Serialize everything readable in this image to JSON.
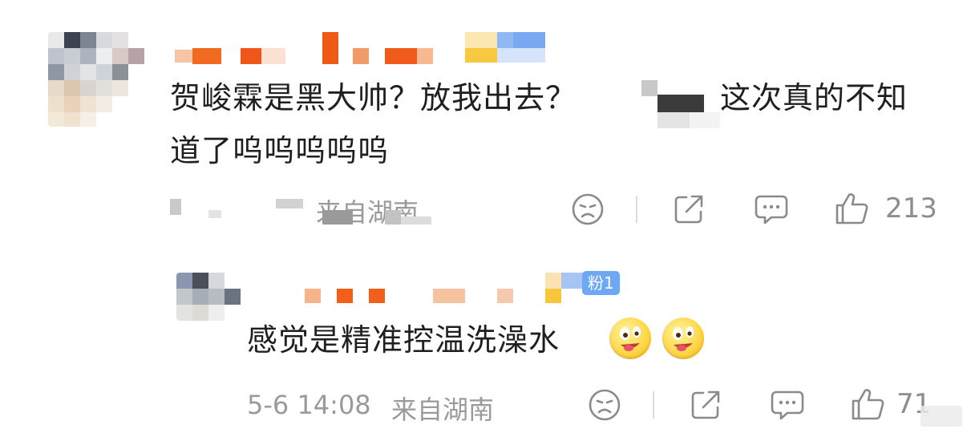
{
  "comment": {
    "text_line1_a": "贺峻霖是黑大帅？放我出去？",
    "text_line1_b": "这次真的不知",
    "text_line2": "道了呜呜呜呜呜",
    "meta_location": "来自湖南",
    "like_count": "213"
  },
  "reply": {
    "fan_badge": "粉1",
    "text": "感觉是精准控温洗澡水",
    "timestamp": "5-6 14:08",
    "location": "来自湖南",
    "like_count": "71"
  },
  "icons": {
    "dislike": "sad-face-icon",
    "share": "share-icon",
    "comment": "comment-bubble-icon",
    "like": "thumbs-up-icon",
    "emoji": "drooling-face-emoji"
  }
}
